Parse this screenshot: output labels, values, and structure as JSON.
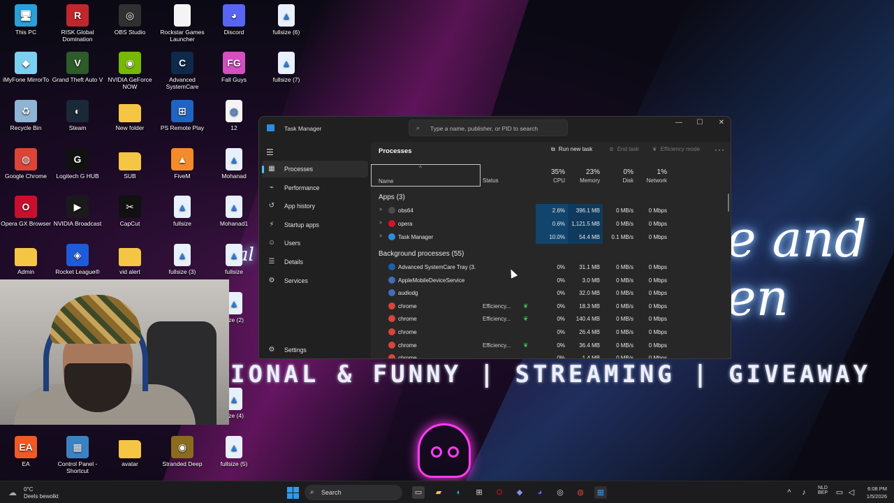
{
  "desktop": {
    "icons": [
      {
        "label": "This PC",
        "glyph": "monitor-icon",
        "color": "#2aa0d8",
        "sym": "🖥"
      },
      {
        "label": "RISK Global Domination",
        "glyph": "risk-icon",
        "color": "#c0272d",
        "sym": "R"
      },
      {
        "label": "OBS Studio",
        "glyph": "obs-icon",
        "color": "#303030",
        "sym": "◎"
      },
      {
        "label": "Rockstar Games Launcher",
        "glyph": "file-icon",
        "color": "#f4f4f4",
        "sym": ""
      },
      {
        "label": "Discord",
        "glyph": "discord-icon",
        "color": "#5865f2",
        "sym": "◕"
      },
      {
        "label": "fullsize (6)",
        "glyph": "image-file-icon",
        "color": "#e8f0fb",
        "sym": "▲"
      },
      {
        "label": "iMyFone MirrorTo",
        "glyph": "mirror-icon",
        "color": "#7bd0f0",
        "sym": "◆"
      },
      {
        "label": "Grand Theft Auto V",
        "glyph": "gta-icon",
        "color": "#2d5b2a",
        "sym": "V"
      },
      {
        "label": "NVIDIA GeForce NOW",
        "glyph": "nvidia-icon",
        "color": "#76b900",
        "sym": "◉"
      },
      {
        "label": "Advanced SystemCare",
        "glyph": "asc-icon",
        "color": "#0d2a4a",
        "sym": "C"
      },
      {
        "label": "Fall Guys",
        "glyph": "fallguys-icon",
        "color": "#d54fc0",
        "sym": "FG"
      },
      {
        "label": "fullsize (7)",
        "glyph": "image-file-icon",
        "color": "#e8f0fb",
        "sym": "▲"
      },
      {
        "label": "Recycle Bin",
        "glyph": "recycle-bin-icon",
        "color": "#8fb5d6",
        "sym": "♻"
      },
      {
        "label": "Steam",
        "glyph": "steam-icon",
        "color": "#1b2838",
        "sym": "◐"
      },
      {
        "label": "New folder",
        "glyph": "folder-icon",
        "color": "#f5c544",
        "sym": ""
      },
      {
        "label": "PS Remote Play",
        "glyph": "ps-remote-icon",
        "color": "#1f64c0",
        "sym": "⊞"
      },
      {
        "label": "12",
        "glyph": "chrome-file-icon",
        "color": "#f4f4f4",
        "sym": "◍"
      },
      {
        "label": "Google Chrome",
        "glyph": "chrome-icon",
        "color": "#db4437",
        "sym": "◍"
      },
      {
        "label": "Logitech G HUB",
        "glyph": "logitech-icon",
        "color": "#111111",
        "sym": "G"
      },
      {
        "label": "SUB",
        "glyph": "folder-icon",
        "color": "#f5c544",
        "sym": ""
      },
      {
        "label": "FiveM",
        "glyph": "fivem-icon",
        "color": "#f38b2a",
        "sym": "▲"
      },
      {
        "label": "Mohanad",
        "glyph": "image-file-icon",
        "color": "#e8f0fb",
        "sym": "▲"
      },
      {
        "label": "Opera GX Browser",
        "glyph": "opera-gx-icon",
        "color": "#c8102e",
        "sym": "O"
      },
      {
        "label": "NVIDIA Broadcast",
        "glyph": "nvidia-broadcast-icon",
        "color": "#1a1a1a",
        "sym": "▶"
      },
      {
        "label": "CapCut",
        "glyph": "capcut-icon",
        "color": "#111111",
        "sym": "✂"
      },
      {
        "label": "fullsize",
        "glyph": "image-file-icon",
        "color": "#e8f0fb",
        "sym": "▲"
      },
      {
        "label": "Mohanad1",
        "glyph": "image-file-icon",
        "color": "#e8f0fb",
        "sym": "▲"
      },
      {
        "label": "Admin",
        "glyph": "folder-icon",
        "color": "#f5c544",
        "sym": ""
      },
      {
        "label": "Rocket League®",
        "glyph": "rocket-league-icon",
        "color": "#1e5bd8",
        "sym": "◈"
      },
      {
        "label": "vid alert",
        "glyph": "folder-icon",
        "color": "#f5c544",
        "sym": ""
      },
      {
        "label": "fullsize (3)",
        "glyph": "image-file-icon",
        "color": "#e8f0fb",
        "sym": "▲"
      },
      {
        "label": "fullsize",
        "glyph": "image-file-icon",
        "color": "#e8f0fb",
        "sym": "▲"
      },
      {
        "label": "size (2)",
        "glyph": "image-file-icon",
        "color": "#e8f0fb",
        "sym": "▲"
      },
      {
        "label": "size (4)",
        "glyph": "image-file-icon",
        "color": "#e8f0fb",
        "sym": "▲"
      },
      {
        "label": "EA",
        "glyph": "ea-icon",
        "color": "#f15a24",
        "sym": "EA"
      },
      {
        "label": "Control Panel - Shortcut",
        "glyph": "control-panel-icon",
        "color": "#3b82c4",
        "sym": "▦"
      },
      {
        "label": "avatar",
        "glyph": "folder-icon",
        "color": "#f5c544",
        "sym": ""
      },
      {
        "label": "Stranded Deep",
        "glyph": "stranded-deep-icon",
        "color": "#8b6b1e",
        "sym": "◉"
      },
      {
        "label": "fullsize (5)",
        "glyph": "image-file-icon",
        "color": "#e8f0fb",
        "sym": "▲"
      }
    ],
    "wallpaper_neon_text": "e and en",
    "wallpaper_neon_left": "al",
    "banner_text": "IONAL & FUNNY | STREAMING | GIVEAWAY"
  },
  "taskmanager": {
    "title": "Task Manager",
    "search_placeholder": "Type a name, publisher, or PID to search",
    "window_buttons": {
      "minimize": "—",
      "maximize": "☐",
      "close": "✕"
    },
    "nav": [
      {
        "label": "Processes",
        "icon": "processes-icon",
        "sym": "▦",
        "active": true
      },
      {
        "label": "Performance",
        "icon": "performance-icon",
        "sym": "⌁",
        "active": false
      },
      {
        "label": "App history",
        "icon": "app-history-icon",
        "sym": "↺",
        "active": false
      },
      {
        "label": "Startup apps",
        "icon": "startup-apps-icon",
        "sym": "⚡",
        "active": false
      },
      {
        "label": "Users",
        "icon": "users-icon",
        "sym": "☺",
        "active": false
      },
      {
        "label": "Details",
        "icon": "details-icon",
        "sym": "☰",
        "active": false
      },
      {
        "label": "Services",
        "icon": "services-icon",
        "sym": "⚙",
        "active": false
      }
    ],
    "settings_label": "Settings",
    "page_title": "Processes",
    "toolbar": {
      "run_new_task": "Run new task",
      "end_task": "End task",
      "efficiency_mode": "Efficiency mode",
      "more": "···"
    },
    "columns": {
      "name": "Name",
      "status": "Status",
      "cpu_pct": "35%",
      "cpu": "CPU",
      "mem_pct": "23%",
      "mem": "Memory",
      "disk_pct": "0%",
      "disk": "Disk",
      "net_pct": "1%",
      "net": "Network"
    },
    "apps_group": "Apps (3)",
    "apps": [
      {
        "name": "obs64",
        "cpu": "2.6%",
        "mem": "396.1 MB",
        "disk": "0 MB/s",
        "net": "0 Mbps",
        "color": "#4a4a4a"
      },
      {
        "name": "opera",
        "cpu": "0.6%",
        "mem": "1,121.5 MB",
        "disk": "0 MB/s",
        "net": "0 Mbps",
        "color": "#d0142c"
      },
      {
        "name": "Task Manager",
        "cpu": "10.0%",
        "mem": "54.4 MB",
        "disk": "0.1 MB/s",
        "net": "0 Mbps",
        "color": "#2b8de0"
      }
    ],
    "bg_group": "Background processes (55)",
    "bg": [
      {
        "name": "Advanced SystemCare Tray (3...",
        "status": "",
        "cpu": "0%",
        "mem": "31.1 MB",
        "disk": "0 MB/s",
        "net": "0 Mbps",
        "color": "#1b5fa8"
      },
      {
        "name": "AppleMobileDeviceService",
        "status": "",
        "cpu": "0%",
        "mem": "3.0 MB",
        "disk": "0 MB/s",
        "net": "0 Mbps",
        "color": "#3e6fb8"
      },
      {
        "name": "audiodg",
        "status": "",
        "cpu": "0%",
        "mem": "32.0 MB",
        "disk": "0 MB/s",
        "net": "0 Mbps",
        "color": "#3e6fb8"
      },
      {
        "name": "chrome",
        "status": "Efficiency...",
        "cpu": "0%",
        "mem": "18.3 MB",
        "disk": "0 MB/s",
        "net": "0 Mbps",
        "color": "#db4437"
      },
      {
        "name": "chrome",
        "status": "Efficiency...",
        "cpu": "0%",
        "mem": "140.4 MB",
        "disk": "0 MB/s",
        "net": "0 Mbps",
        "color": "#db4437"
      },
      {
        "name": "chrome",
        "status": "",
        "cpu": "0%",
        "mem": "26.4 MB",
        "disk": "0 MB/s",
        "net": "0 Mbps",
        "color": "#db4437"
      },
      {
        "name": "chrome",
        "status": "Efficiency...",
        "cpu": "0%",
        "mem": "36.4 MB",
        "disk": "0 MB/s",
        "net": "0 Mbps",
        "color": "#db4437"
      },
      {
        "name": "chrome",
        "status": "",
        "cpu": "0%",
        "mem": "1.4 MB",
        "disk": "0 MB/s",
        "net": "0 Mbps",
        "color": "#db4437"
      }
    ]
  },
  "taskbar": {
    "weather_temp": "0°C",
    "weather_desc": "Deels bewolkt",
    "search_label": "Search",
    "lang_1": "NLD",
    "lang_2": "BEP",
    "time": "6:08 PM",
    "date": "1/5/2026"
  }
}
